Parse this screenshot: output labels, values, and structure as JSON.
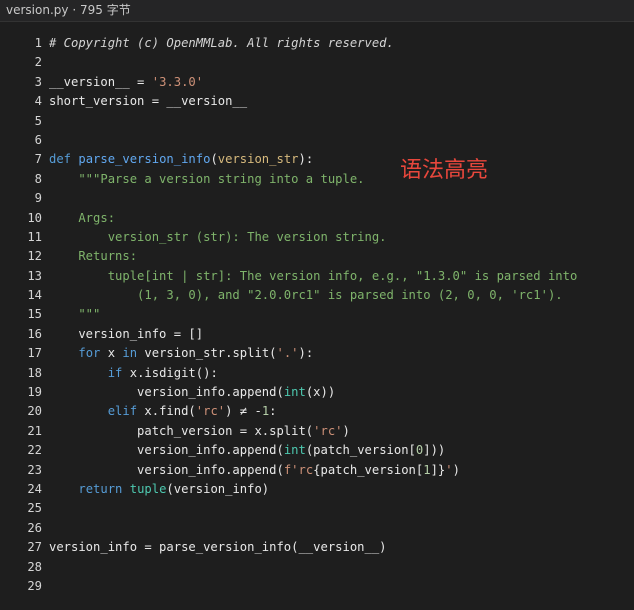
{
  "header": {
    "filename": "version.py",
    "separator": "·",
    "filesize": "795 字节"
  },
  "overlay_text": "语法高亮",
  "colors": {
    "background": "#1e1e1e",
    "keyword": "#569cd6",
    "function": "#61a8f0",
    "string": "#ce9178",
    "docstring": "#7fb46b",
    "overlay": "#e8473c"
  },
  "code": {
    "lines": [
      {
        "n": "1",
        "tokens": [
          {
            "t": "# Copyright (c) OpenMMLab. All rights reserved.",
            "c": "comment"
          }
        ]
      },
      {
        "n": "2",
        "tokens": []
      },
      {
        "n": "3",
        "tokens": [
          {
            "t": "__version__ = ",
            "c": "plain"
          },
          {
            "t": "'3.3.0'",
            "c": "string"
          }
        ]
      },
      {
        "n": "4",
        "tokens": [
          {
            "t": "short_version = __version__",
            "c": "plain"
          }
        ]
      },
      {
        "n": "5",
        "tokens": []
      },
      {
        "n": "6",
        "tokens": []
      },
      {
        "n": "7",
        "tokens": [
          {
            "t": "def ",
            "c": "keyword"
          },
          {
            "t": "parse_version_info",
            "c": "func"
          },
          {
            "t": "(",
            "c": "plain"
          },
          {
            "t": "version_str",
            "c": "param"
          },
          {
            "t": "):",
            "c": "plain"
          }
        ]
      },
      {
        "n": "8",
        "tokens": [
          {
            "t": "    \"\"\"Parse a version string into a tuple.",
            "c": "doc"
          }
        ]
      },
      {
        "n": "9",
        "tokens": []
      },
      {
        "n": "10",
        "tokens": [
          {
            "t": "    Args:",
            "c": "doc"
          }
        ]
      },
      {
        "n": "11",
        "tokens": [
          {
            "t": "        version_str (str): The version string.",
            "c": "doc"
          }
        ]
      },
      {
        "n": "12",
        "tokens": [
          {
            "t": "    Returns:",
            "c": "doc"
          }
        ]
      },
      {
        "n": "13",
        "tokens": [
          {
            "t": "        tuple[int | str]: The version info, e.g., \"1.3.0\" is parsed into",
            "c": "doc"
          }
        ]
      },
      {
        "n": "14",
        "tokens": [
          {
            "t": "            (1, 3, 0), and \"2.0.0rc1\" is parsed into (2, 0, 0, 'rc1').",
            "c": "doc"
          }
        ]
      },
      {
        "n": "15",
        "tokens": [
          {
            "t": "    \"\"\"",
            "c": "doc"
          }
        ]
      },
      {
        "n": "16",
        "tokens": [
          {
            "t": "    version_info = []",
            "c": "plain"
          }
        ]
      },
      {
        "n": "17",
        "tokens": [
          {
            "t": "    ",
            "c": "plain"
          },
          {
            "t": "for",
            "c": "keyword"
          },
          {
            "t": " x ",
            "c": "plain"
          },
          {
            "t": "in",
            "c": "keyword"
          },
          {
            "t": " version_str.split(",
            "c": "plain"
          },
          {
            "t": "'.'",
            "c": "string"
          },
          {
            "t": "):",
            "c": "plain"
          }
        ]
      },
      {
        "n": "18",
        "tokens": [
          {
            "t": "        ",
            "c": "plain"
          },
          {
            "t": "if",
            "c": "keyword"
          },
          {
            "t": " x.isdigit():",
            "c": "plain"
          }
        ]
      },
      {
        "n": "19",
        "tokens": [
          {
            "t": "            version_info.append(",
            "c": "plain"
          },
          {
            "t": "int",
            "c": "builtin"
          },
          {
            "t": "(x))",
            "c": "plain"
          }
        ]
      },
      {
        "n": "20",
        "tokens": [
          {
            "t": "        ",
            "c": "plain"
          },
          {
            "t": "elif",
            "c": "keyword"
          },
          {
            "t": " x.find(",
            "c": "plain"
          },
          {
            "t": "'rc'",
            "c": "string"
          },
          {
            "t": ") ≠ -",
            "c": "plain"
          },
          {
            "t": "1",
            "c": "number"
          },
          {
            "t": ":",
            "c": "plain"
          }
        ]
      },
      {
        "n": "21",
        "tokens": [
          {
            "t": "            patch_version = x.split(",
            "c": "plain"
          },
          {
            "t": "'rc'",
            "c": "string"
          },
          {
            "t": ")",
            "c": "plain"
          }
        ]
      },
      {
        "n": "22",
        "tokens": [
          {
            "t": "            version_info.append(",
            "c": "plain"
          },
          {
            "t": "int",
            "c": "builtin"
          },
          {
            "t": "(patch_version[",
            "c": "plain"
          },
          {
            "t": "0",
            "c": "number"
          },
          {
            "t": "]))",
            "c": "plain"
          }
        ]
      },
      {
        "n": "23",
        "tokens": [
          {
            "t": "            version_info.append(",
            "c": "plain"
          },
          {
            "t": "f'rc",
            "c": "string"
          },
          {
            "t": "{patch_version[",
            "c": "plain"
          },
          {
            "t": "1",
            "c": "number"
          },
          {
            "t": "]}",
            "c": "plain"
          },
          {
            "t": "'",
            "c": "string"
          },
          {
            "t": ")",
            "c": "plain"
          }
        ]
      },
      {
        "n": "24",
        "tokens": [
          {
            "t": "    ",
            "c": "plain"
          },
          {
            "t": "return",
            "c": "keyword"
          },
          {
            "t": " ",
            "c": "plain"
          },
          {
            "t": "tuple",
            "c": "builtin"
          },
          {
            "t": "(version_info)",
            "c": "plain"
          }
        ]
      },
      {
        "n": "25",
        "tokens": []
      },
      {
        "n": "26",
        "tokens": []
      },
      {
        "n": "27",
        "tokens": [
          {
            "t": "version_info = parse_version_info(__version__)",
            "c": "plain"
          }
        ]
      },
      {
        "n": "28",
        "tokens": []
      },
      {
        "n": "29",
        "tokens": []
      }
    ]
  }
}
